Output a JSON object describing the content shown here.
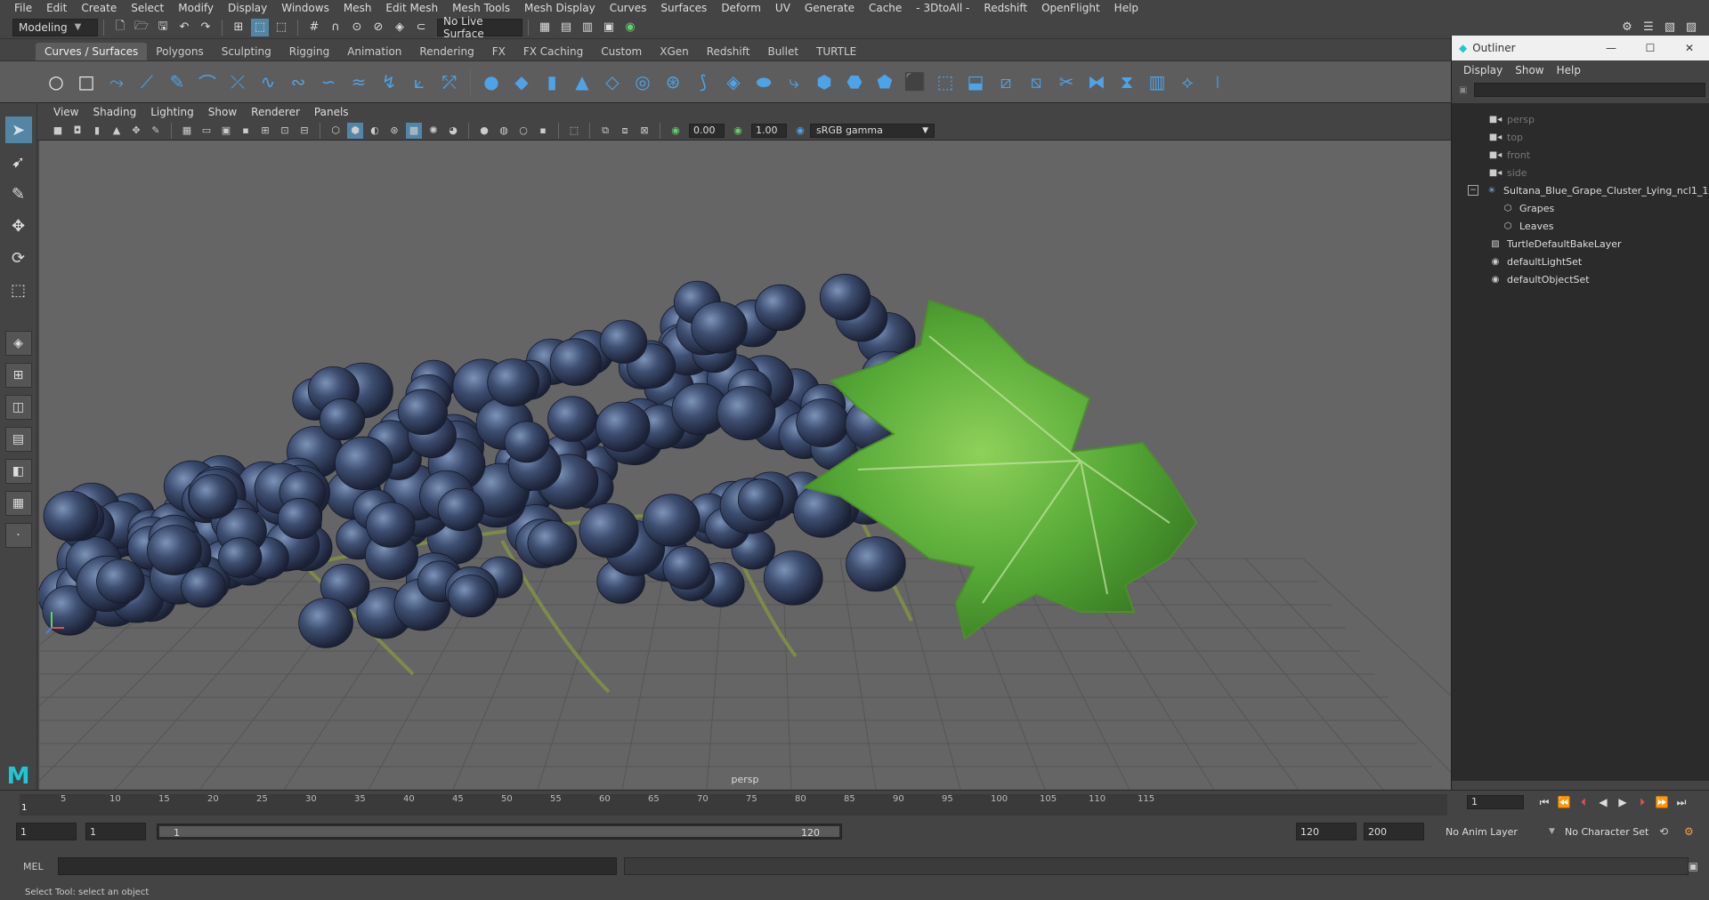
{
  "menubar": [
    "File",
    "Edit",
    "Create",
    "Select",
    "Modify",
    "Display",
    "Windows",
    "Mesh",
    "Edit Mesh",
    "Mesh Tools",
    "Mesh Display",
    "Curves",
    "Surfaces",
    "Deform",
    "UV",
    "Generate",
    "Cache",
    "- 3DtoAll -",
    "Redshift",
    "OpenFlight",
    "Help"
  ],
  "statusline": {
    "mode": "Modeling",
    "live_surface": "No Live Surface"
  },
  "shelf_tabs": [
    "Curves / Surfaces",
    "Polygons",
    "Sculpting",
    "Rigging",
    "Animation",
    "Rendering",
    "FX",
    "FX Caching",
    "Custom",
    "XGen",
    "Redshift",
    "Bullet",
    "TURTLE"
  ],
  "viewport": {
    "menus": [
      "View",
      "Shading",
      "Lighting",
      "Show",
      "Renderer",
      "Panels"
    ],
    "exposure": "0.00",
    "gamma": "1.00",
    "color_space": "sRGB gamma",
    "camera_label": "persp"
  },
  "outliner": {
    "title": "Outliner",
    "menus": [
      "Display",
      "Show",
      "Help"
    ],
    "items": [
      {
        "label": "persp",
        "icon": "camera-icon",
        "dim": true
      },
      {
        "label": "top",
        "icon": "camera-icon",
        "dim": true
      },
      {
        "label": "front",
        "icon": "camera-icon",
        "dim": true
      },
      {
        "label": "side",
        "icon": "camera-icon",
        "dim": true
      },
      {
        "label": "Sultana_Blue_Grape_Cluster_Lying_ncl1_1",
        "icon": "group-icon",
        "dim": false
      },
      {
        "label": "Grapes",
        "icon": "mesh-icon",
        "dim": false
      },
      {
        "label": "Leaves",
        "icon": "mesh-icon",
        "dim": false
      },
      {
        "label": "TurtleDefaultBakeLayer",
        "icon": "layer-icon",
        "dim": false
      },
      {
        "label": "defaultLightSet",
        "icon": "set-icon",
        "dim": false
      },
      {
        "label": "defaultObjectSet",
        "icon": "set-icon",
        "dim": false
      }
    ]
  },
  "timeslider": {
    "ticks": [
      "5",
      "10",
      "15",
      "20",
      "25",
      "30",
      "35",
      "40",
      "45",
      "50",
      "55",
      "60",
      "65",
      "70",
      "75",
      "80",
      "85",
      "90",
      "95",
      "100",
      "105",
      "110",
      "115"
    ],
    "first_tick": "1",
    "current_frame": "1"
  },
  "rangeslider": {
    "start": "1",
    "playback_start": "1",
    "bar_start": "1",
    "bar_end": "120",
    "playback_end": "120",
    "end": "200",
    "anim_layer": "No Anim Layer",
    "character_set": "No Character Set"
  },
  "cmdline": {
    "label": "MEL"
  },
  "helpline": {
    "text": "Select Tool: select an object"
  },
  "colors": {
    "accent": "#5285a6",
    "shelf_icon": "#4da3e8",
    "viewport_bg": "#656565",
    "grape": "#2a3550",
    "leaf": "#5aa838"
  }
}
